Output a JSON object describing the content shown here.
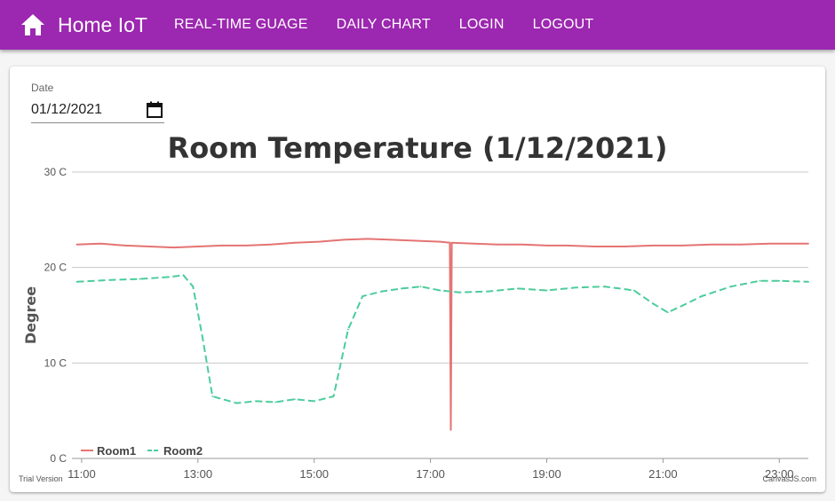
{
  "appbar": {
    "title": "Home IoT",
    "home_icon": "home-icon",
    "nav": [
      "REAL-TIME GUAGE",
      "DAILY CHART",
      "LOGIN",
      "LOGOUT"
    ]
  },
  "colors": {
    "appbar": "#9c27b0",
    "room1": "#e57373",
    "room2": "#4ccc9c"
  },
  "date_picker": {
    "label": "Date",
    "value": "01/12/2021",
    "icon": "calendar-icon"
  },
  "footer": {
    "trial": "Trial Version",
    "credit": "CanvasJS.com"
  },
  "chart_data": {
    "type": "line",
    "title": "Room Temperature (1/12/2021)",
    "ylabel": "Degree",
    "xlabel": "",
    "ylim": [
      0,
      30
    ],
    "xlim": [
      "10:50",
      "23:30"
    ],
    "y_ticks": [
      "0 C",
      "10 C",
      "20 C",
      "30 C"
    ],
    "x_ticks": [
      "11:00",
      "13:00",
      "15:00",
      "17:00",
      "19:00",
      "21:00",
      "23:00"
    ],
    "grid": true,
    "legend": "bottom-left",
    "series": [
      {
        "name": "Room1",
        "style": "solid",
        "points": [
          [
            "10:55",
            22.4
          ],
          [
            "11:20",
            22.5
          ],
          [
            "11:45",
            22.3
          ],
          [
            "12:10",
            22.2
          ],
          [
            "12:35",
            22.1
          ],
          [
            "13:00",
            22.2
          ],
          [
            "13:25",
            22.3
          ],
          [
            "13:50",
            22.3
          ],
          [
            "14:15",
            22.4
          ],
          [
            "14:40",
            22.6
          ],
          [
            "15:05",
            22.7
          ],
          [
            "15:30",
            22.9
          ],
          [
            "15:55",
            23.0
          ],
          [
            "16:20",
            22.9
          ],
          [
            "16:45",
            22.8
          ],
          [
            "17:10",
            22.7
          ],
          [
            "17:20",
            22.6
          ],
          [
            "17:21",
            3.0
          ],
          [
            "17:22",
            22.6
          ],
          [
            "17:45",
            22.5
          ],
          [
            "18:10",
            22.4
          ],
          [
            "18:35",
            22.4
          ],
          [
            "19:00",
            22.3
          ],
          [
            "19:20",
            22.3
          ],
          [
            "19:50",
            22.2
          ],
          [
            "20:20",
            22.2
          ],
          [
            "20:50",
            22.3
          ],
          [
            "21:20",
            22.3
          ],
          [
            "21:50",
            22.4
          ],
          [
            "22:20",
            22.4
          ],
          [
            "22:50",
            22.5
          ],
          [
            "23:30",
            22.5
          ]
        ]
      },
      {
        "name": "Room2",
        "style": "dashed",
        "points": [
          [
            "10:55",
            18.5
          ],
          [
            "11:30",
            18.7
          ],
          [
            "12:00",
            18.8
          ],
          [
            "12:30",
            19.0
          ],
          [
            "12:45",
            19.2
          ],
          [
            "12:55",
            18.0
          ],
          [
            "13:05",
            12.5
          ],
          [
            "13:15",
            6.5
          ],
          [
            "13:40",
            5.8
          ],
          [
            "14:00",
            6.0
          ],
          [
            "14:20",
            5.9
          ],
          [
            "14:40",
            6.2
          ],
          [
            "15:00",
            6.0
          ],
          [
            "15:20",
            6.5
          ],
          [
            "15:35",
            13.5
          ],
          [
            "15:50",
            17.0
          ],
          [
            "16:10",
            17.5
          ],
          [
            "16:30",
            17.8
          ],
          [
            "16:50",
            18.0
          ],
          [
            "17:10",
            17.6
          ],
          [
            "17:30",
            17.4
          ],
          [
            "18:00",
            17.5
          ],
          [
            "18:30",
            17.8
          ],
          [
            "19:00",
            17.6
          ],
          [
            "19:30",
            17.9
          ],
          [
            "20:00",
            18.0
          ],
          [
            "20:30",
            17.6
          ],
          [
            "20:50",
            16.2
          ],
          [
            "21:05",
            15.3
          ],
          [
            "21:20",
            16.0
          ],
          [
            "21:40",
            17.0
          ],
          [
            "22:10",
            18.0
          ],
          [
            "22:40",
            18.6
          ],
          [
            "23:00",
            18.6
          ],
          [
            "23:30",
            18.5
          ]
        ]
      }
    ]
  }
}
